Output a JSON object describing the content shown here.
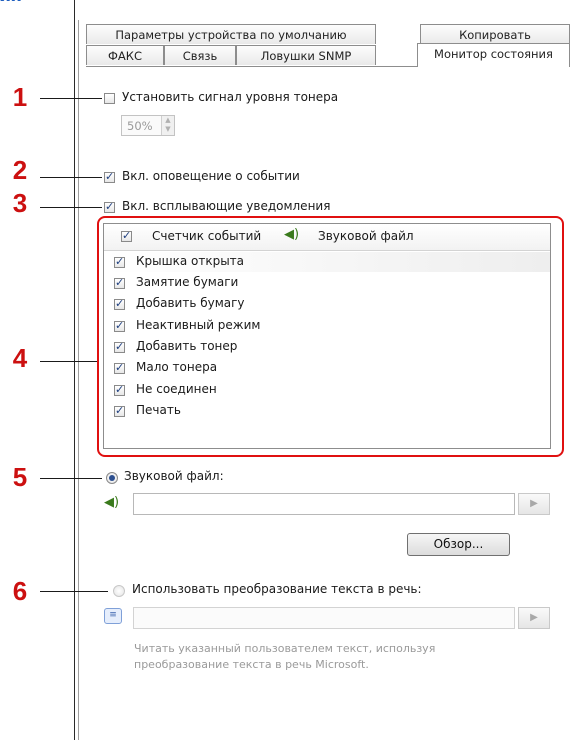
{
  "page": {
    "heading_fragment": "ия"
  },
  "tabs": {
    "row1": [
      "Параметры устройства по умолчанию",
      "Копировать"
    ],
    "row2": [
      "ФАКС",
      "Связь",
      "Ловушки SNMP",
      "Монитор состояния"
    ],
    "active": "Монитор состояния"
  },
  "callouts": [
    "1",
    "2",
    "3",
    "4",
    "5",
    "6"
  ],
  "toner": {
    "label": "Установить сигнал уровня тонера",
    "checked": false,
    "value": "50%"
  },
  "event_notify": {
    "label": "Вкл. оповещение о событии",
    "checked": true
  },
  "popups": {
    "label": "Вкл. всплывающие уведомления",
    "checked": true
  },
  "event_list": {
    "columns": [
      "Счетчик событий",
      "Звуковой файл"
    ],
    "header_checked": true,
    "items": [
      {
        "label": "Крышка открыта",
        "checked": true
      },
      {
        "label": "Замятие бумаги",
        "checked": true
      },
      {
        "label": "Добавить бумагу",
        "checked": true
      },
      {
        "label": "Неактивный режим",
        "checked": true
      },
      {
        "label": "Добавить тонер",
        "checked": true
      },
      {
        "label": "Мало тонера",
        "checked": true
      },
      {
        "label": "Не соединен",
        "checked": true
      },
      {
        "label": "Печать",
        "checked": true
      }
    ]
  },
  "sound": {
    "label": "Звуковой файл:",
    "selected": true,
    "value": "",
    "browse_label": "Обзор...",
    "play_glyph": "▶"
  },
  "tts": {
    "label": "Использовать преобразование текста в речь:",
    "selected": false,
    "value": "",
    "play_glyph": "▶",
    "hint": [
      "Читать указанный пользователем текст, используя",
      "преобразование текста в речь Microsoft."
    ]
  },
  "colors": {
    "callout": "#cc1010",
    "highlight_box": "#e01010",
    "heading": "#1f5fbf"
  },
  "icons": [
    "speaker-icon",
    "text-to-speech-icon",
    "play-icon"
  ]
}
